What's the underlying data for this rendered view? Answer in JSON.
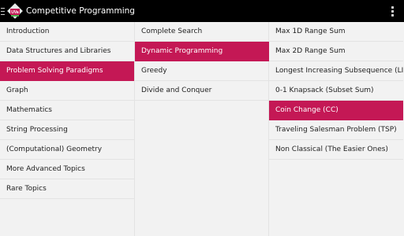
{
  "app": {
    "title": "Competitive Programming",
    "icon_name": "uva-logo-icon",
    "icon_text": "UVa"
  },
  "colors": {
    "actionbar": "#000000",
    "selected": "#c41855",
    "background": "#f2f2f2"
  },
  "columns": {
    "categories": [
      {
        "label": "Introduction",
        "selected": false
      },
      {
        "label": "Data Structures and Libraries",
        "selected": false
      },
      {
        "label": "Problem Solving Paradigms",
        "selected": true
      },
      {
        "label": "Graph",
        "selected": false
      },
      {
        "label": "Mathematics",
        "selected": false
      },
      {
        "label": "String Processing",
        "selected": false
      },
      {
        "label": "(Computational) Geometry",
        "selected": false
      },
      {
        "label": "More Advanced Topics",
        "selected": false
      },
      {
        "label": "Rare Topics",
        "selected": false
      }
    ],
    "paradigms": [
      {
        "label": "Complete Search",
        "selected": false
      },
      {
        "label": "Dynamic Programming",
        "selected": true
      },
      {
        "label": "Greedy",
        "selected": false
      },
      {
        "label": "Divide and Conquer",
        "selected": false
      }
    ],
    "problems": [
      {
        "label": "Max 1D Range Sum",
        "selected": false
      },
      {
        "label": "Max 2D Range Sum",
        "selected": false
      },
      {
        "label": "Longest Increasing Subsequence (LIS)",
        "selected": false
      },
      {
        "label": "0-1 Knapsack (Subset Sum)",
        "selected": false
      },
      {
        "label": "Coin Change (CC)",
        "selected": true
      },
      {
        "label": "Traveling Salesman Problem (TSP)",
        "selected": false
      },
      {
        "label": "Non Classical (The Easier Ones)",
        "selected": false
      }
    ]
  }
}
